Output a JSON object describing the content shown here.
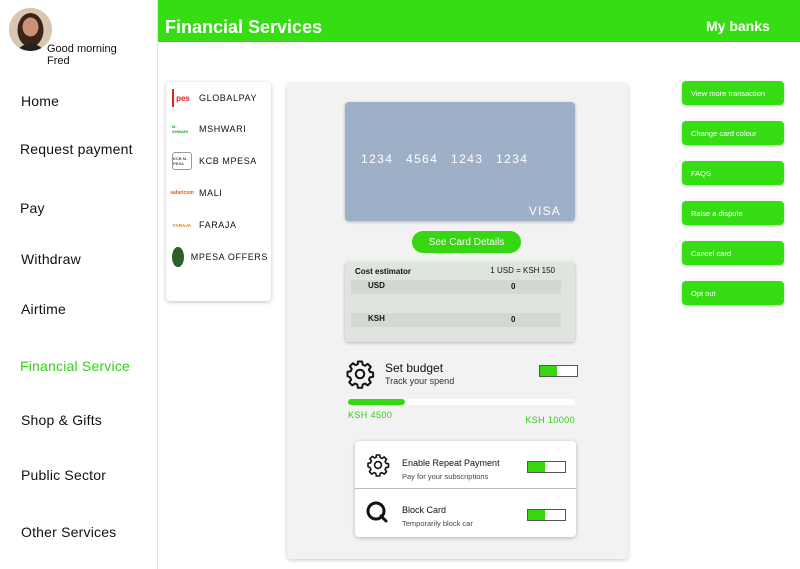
{
  "user": {
    "greeting": "Good morning",
    "name": "Fred"
  },
  "header": {
    "title": "Financial Services",
    "link": "My banks"
  },
  "nav": [
    {
      "label": "Home"
    },
    {
      "label": "Request payment"
    },
    {
      "label": "Pay"
    },
    {
      "label": "Withdraw"
    },
    {
      "label": "Airtime"
    },
    {
      "label": "Financial Service",
      "active": true
    },
    {
      "label": "Shop & Gifts"
    },
    {
      "label": "Public Sector"
    },
    {
      "label": "Other Services"
    }
  ],
  "banks": [
    {
      "label": "GLOBALPAY",
      "logo_text": "pes"
    },
    {
      "label": "MSHWARI",
      "logo_text": "M-SHWARI"
    },
    {
      "label": "KCB MPESA",
      "logo_text": "KCB M-PESA"
    },
    {
      "label": "MALI",
      "logo_text": "safaricom"
    },
    {
      "label": "FARAJA",
      "logo_text": "FARAJA"
    },
    {
      "label": "MPESA OFFERS"
    }
  ],
  "card": {
    "number": "1234 4564 1243 1234",
    "brand": "VISA",
    "details_button": "See Card Details"
  },
  "estimator": {
    "title": "Cost estimator",
    "rate": "1 USD = KSH 150",
    "rows": [
      {
        "label": "USD",
        "value": "0"
      },
      {
        "label": "KSH",
        "value": "0"
      }
    ]
  },
  "budget": {
    "title": "Set budget",
    "subtitle": "Track your spend",
    "spent": "KSH 4500",
    "limit": "KSH 10000",
    "progress_fraction": 0.25,
    "enabled": true
  },
  "options": [
    {
      "title": "Enable Repeat Payment",
      "subtitle": "Pay for your subscriptions",
      "enabled": true
    },
    {
      "title": "Block Card",
      "subtitle": "Temporarily block car",
      "enabled": true
    }
  ],
  "actions": [
    {
      "label": "View more transaction"
    },
    {
      "label": "Change card colour"
    },
    {
      "label": "FAQS"
    },
    {
      "label": "Raise a dispute"
    },
    {
      "label": "Cancel card"
    },
    {
      "label": "Opt out"
    }
  ],
  "colors": {
    "accent": "#37dd14",
    "card": "#9eafc8"
  }
}
